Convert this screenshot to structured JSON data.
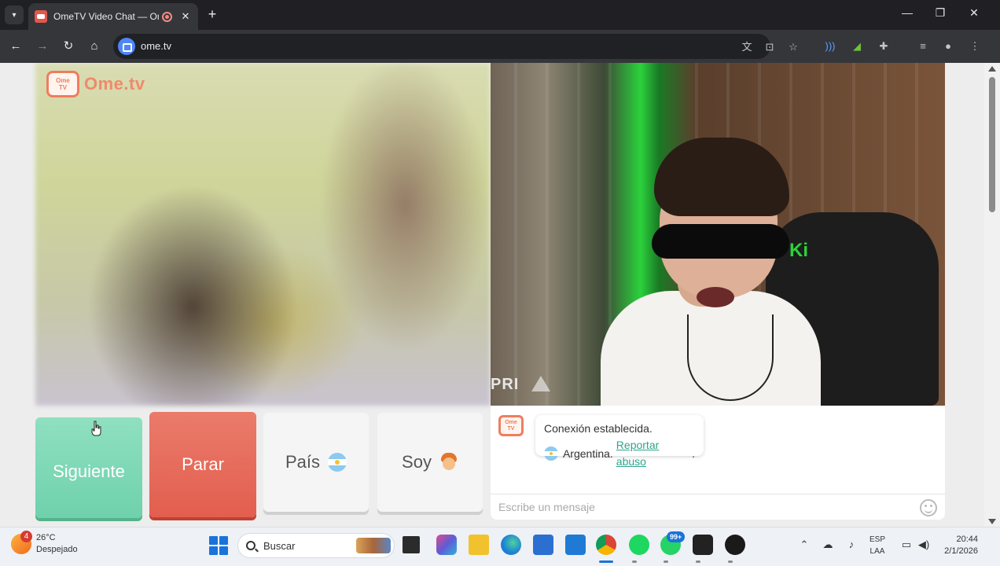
{
  "browser": {
    "tab_title": "OmeTV Video Chat — Ome",
    "url": "ome.tv"
  },
  "site": {
    "logo_small_1": "Ome",
    "logo_small_2": "TV",
    "logo_text": "Ome.tv"
  },
  "video": {
    "watermark": "PRI"
  },
  "buttons": {
    "next": "Siguiente",
    "stop": "Parar",
    "country": "País",
    "gender": "Soy"
  },
  "chat": {
    "status": "Conexión establecida.",
    "country": "Argentina.",
    "report_link": "Reportar abuso",
    "report_suffix": ".",
    "input_placeholder": "Escribe un mensaje"
  },
  "taskbar": {
    "weather_badge": "4",
    "temperature": "26°C",
    "weather": "Despejado",
    "search_placeholder": "Buscar",
    "whatsapp_badge": "99+",
    "lang_1": "ESP",
    "lang_2": "LAA",
    "time": "20:44",
    "date": "2/1/2026"
  },
  "colors": {
    "next_button": "#6fd1ac",
    "stop_button": "#e35e4e",
    "accent_link": "#2fa58a",
    "brand_orange": "#ef7d5f"
  }
}
